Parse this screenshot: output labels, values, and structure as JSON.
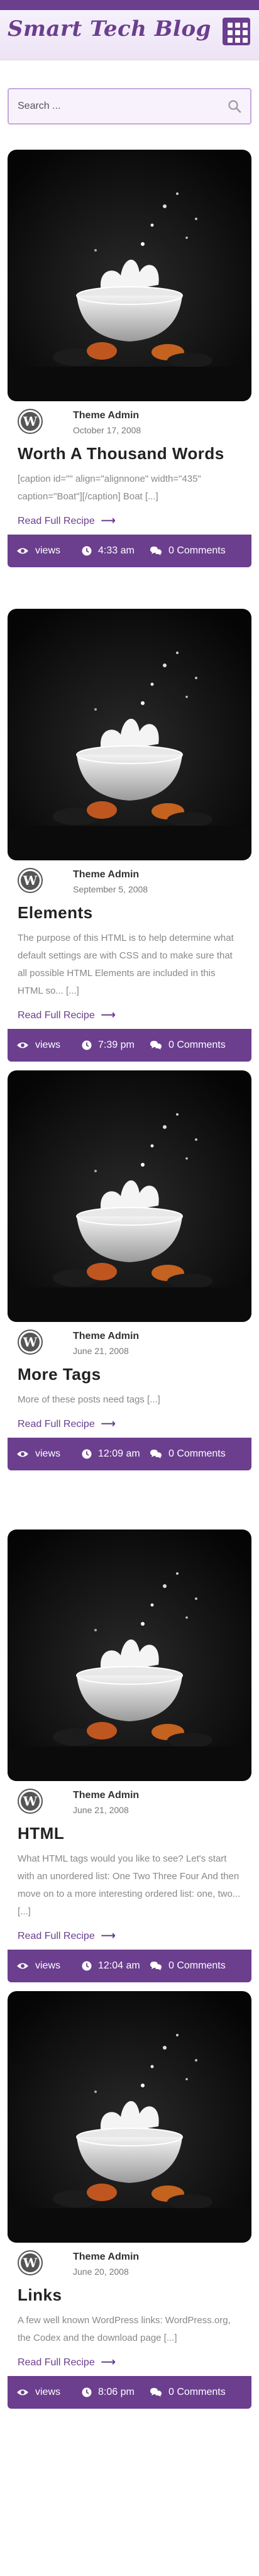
{
  "brand": {
    "title": "Smart Tech Blog",
    "accent": "#6b3e8e"
  },
  "search": {
    "placeholder": "Search ..."
  },
  "posts": [
    {
      "author": "Theme Admin",
      "date": "October 17, 2008",
      "title": "Worth A Thousand Words",
      "excerpt": "[caption id=\"\" align=\"alignnone\" width=\"435\" caption=\"Boat\"][/caption] Boat [...]",
      "read_more": "Read Full Recipe",
      "views_label": "views",
      "time": "4:33 am",
      "comments": "0 Comments"
    },
    {
      "author": "Theme Admin",
      "date": "September 5, 2008",
      "title": "Elements",
      "excerpt": "The purpose of this HTML is to help determine what default settings are with CSS and to make sure that all possible HTML Elements are included in this HTML so... [...]",
      "read_more": "Read Full Recipe",
      "views_label": "views",
      "time": "7:39 pm",
      "comments": "0 Comments"
    },
    {
      "author": "Theme Admin",
      "date": "June 21, 2008",
      "title": "More Tags",
      "excerpt": "More of these posts need tags [...]",
      "read_more": "Read Full Recipe",
      "views_label": "views",
      "time": "12:09 am",
      "comments": "0 Comments"
    },
    {
      "author": "Theme Admin",
      "date": "June 21, 2008",
      "title": "HTML",
      "excerpt": "What HTML tags would you like to see? Let's start with an unordered list: One Two Three Four And then move on to a more interesting ordered list: one, two... [...]",
      "read_more": "Read Full Recipe",
      "views_label": "views",
      "time": "12:04 am",
      "comments": "0 Comments"
    },
    {
      "author": "Theme Admin",
      "date": "June 20, 2008",
      "title": "Links",
      "excerpt": "A few well known WordPress links: WordPress.org, the Codex and the download page [...]",
      "read_more": "Read Full Recipe",
      "views_label": "views",
      "time": "8:06 pm",
      "comments": "0 Comments"
    }
  ]
}
